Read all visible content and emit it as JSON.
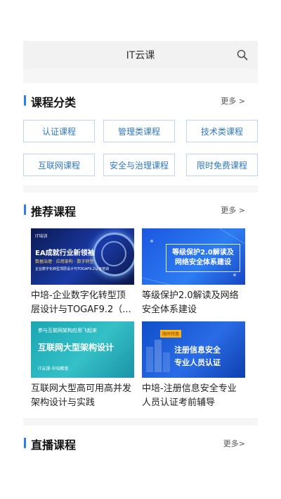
{
  "header": {
    "title": "IT云课"
  },
  "categories": {
    "title": "课程分类",
    "more": "更多 >",
    "items": [
      "认证课程",
      "管理类课程",
      "技术类课程",
      "互联网课程",
      "安全与治理课程",
      "限时免费课程"
    ]
  },
  "recommended": {
    "title": "推荐课程",
    "more": "更多 >",
    "courses": [
      {
        "title": "中培-企业数字化转型顶层设计与TOGAF9.2（...",
        "thumb_text": {
          "tag": "IT培训",
          "headline": "EA成就行业新领袖",
          "sub1": "数据治理 · 应用架构 · 数字转型",
          "sub2": "企业数字化转型顶层设计与TOGAF9.2认证培训"
        }
      },
      {
        "title": "等级保护2.0解读及网络安全体系建设",
        "thumb_text": {
          "line1": "等级保护2.0解读及",
          "line2": "网络安全体系建设"
        }
      },
      {
        "title": "互联网大型高可用高并发架构设计与实践",
        "thumb_text": {
          "top": "参与互联网架构应用飞起来",
          "headline": "互联网大型架构设计",
          "brand": "IT云课·中培教育"
        }
      },
      {
        "title": "中培-注册信息安全专业人员认证考前辅导",
        "thumb_text": {
          "tag": "限时特惠",
          "line1": "注册信息安全",
          "line2": "专业人员认证"
        }
      }
    ]
  },
  "live": {
    "title": "直播课程",
    "more": "更多>"
  }
}
